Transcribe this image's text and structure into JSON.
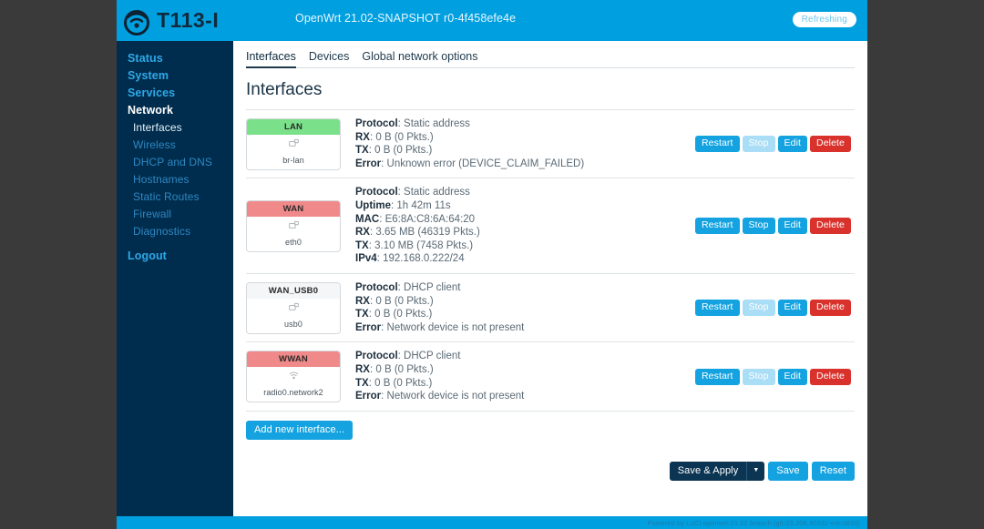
{
  "header": {
    "logo_icon": "wifi-logo-icon",
    "brand": "T113-I",
    "firmware": "OpenWrt 21.02-SNAPSHOT r0-4f458efe4e",
    "status_badge": "Refreshing",
    "bg_color": "#00a0e0"
  },
  "sidebar": {
    "bg_color": "#002d4d",
    "items": [
      {
        "label": "Status",
        "active": false
      },
      {
        "label": "System",
        "active": false
      },
      {
        "label": "Services",
        "active": false
      },
      {
        "label": "Network",
        "active": true
      }
    ],
    "sub_items": [
      {
        "label": "Interfaces",
        "active": true
      },
      {
        "label": "Wireless",
        "active": false
      },
      {
        "label": "DHCP and DNS",
        "active": false
      },
      {
        "label": "Hostnames",
        "active": false
      },
      {
        "label": "Static Routes",
        "active": false
      },
      {
        "label": "Firewall",
        "active": false
      },
      {
        "label": "Diagnostics",
        "active": false
      }
    ],
    "logout": "Logout"
  },
  "main": {
    "tabs": [
      {
        "label": "Interfaces",
        "active": true
      },
      {
        "label": "Devices",
        "active": false
      },
      {
        "label": "Global network options",
        "active": false
      }
    ],
    "page_title": "Interfaces",
    "add_button": "Add new interface...",
    "interfaces": [
      {
        "name": "LAN",
        "badge_color": "#7ae08a",
        "device": "br-lan",
        "device_icon": "ethernet-icon",
        "fields": [
          {
            "label": "Protocol",
            "value": "Static address"
          },
          {
            "label": "RX",
            "value": "0 B (0 Pkts.)"
          },
          {
            "label": "TX",
            "value": "0 B (0 Pkts.)"
          },
          {
            "label": "Error",
            "value": "Unknown error (DEVICE_CLAIM_FAILED)"
          }
        ],
        "actions": [
          {
            "label": "Restart",
            "style": "blue"
          },
          {
            "label": "Stop",
            "style": "blue-light"
          },
          {
            "label": "Edit",
            "style": "blue"
          },
          {
            "label": "Delete",
            "style": "red"
          }
        ]
      },
      {
        "name": "WAN",
        "badge_color": "#f08a8a",
        "device": "eth0",
        "device_icon": "ethernet-icon",
        "fields": [
          {
            "label": "Protocol",
            "value": "Static address"
          },
          {
            "label": "Uptime",
            "value": "1h 42m 11s"
          },
          {
            "label": "MAC",
            "value": "E6:8A:C8:6A:64:20"
          },
          {
            "label": "RX",
            "value": "3.65 MB (46319 Pkts.)"
          },
          {
            "label": "TX",
            "value": "3.10 MB (7458 Pkts.)"
          },
          {
            "label": "IPv4",
            "value": "192.168.0.222/24"
          }
        ],
        "actions": [
          {
            "label": "Restart",
            "style": "blue"
          },
          {
            "label": "Stop",
            "style": "blue"
          },
          {
            "label": "Edit",
            "style": "blue"
          },
          {
            "label": "Delete",
            "style": "red"
          }
        ]
      },
      {
        "name": "WAN_USB0",
        "badge_color": "#f4f6f7",
        "device": "usb0",
        "device_icon": "ethernet-icon",
        "fields": [
          {
            "label": "Protocol",
            "value": "DHCP client"
          },
          {
            "label": "RX",
            "value": "0 B (0 Pkts.)"
          },
          {
            "label": "TX",
            "value": "0 B (0 Pkts.)"
          },
          {
            "label": "Error",
            "value": "Network device is not present"
          }
        ],
        "actions": [
          {
            "label": "Restart",
            "style": "blue"
          },
          {
            "label": "Stop",
            "style": "blue-light"
          },
          {
            "label": "Edit",
            "style": "blue"
          },
          {
            "label": "Delete",
            "style": "red"
          }
        ]
      },
      {
        "name": "WWAN",
        "badge_color": "#f08a8a",
        "device": "radio0.network2",
        "device_icon": "wireless-icon",
        "fields": [
          {
            "label": "Protocol",
            "value": "DHCP client"
          },
          {
            "label": "RX",
            "value": "0 B (0 Pkts.)"
          },
          {
            "label": "TX",
            "value": "0 B (0 Pkts.)"
          },
          {
            "label": "Error",
            "value": "Network device is not present"
          }
        ],
        "actions": [
          {
            "label": "Restart",
            "style": "blue"
          },
          {
            "label": "Stop",
            "style": "blue-light"
          },
          {
            "label": "Edit",
            "style": "blue"
          },
          {
            "label": "Delete",
            "style": "red"
          }
        ]
      }
    ],
    "save_apply": "Save & Apply",
    "save_apply_arrow": "▼",
    "save": "Save",
    "reset": "Reset"
  },
  "footer": {
    "text": "Powered by LuCI openwrt-21.02 branch (git-23.208.40332-e4c4833)",
    "bg_color": "#00a0e0"
  }
}
